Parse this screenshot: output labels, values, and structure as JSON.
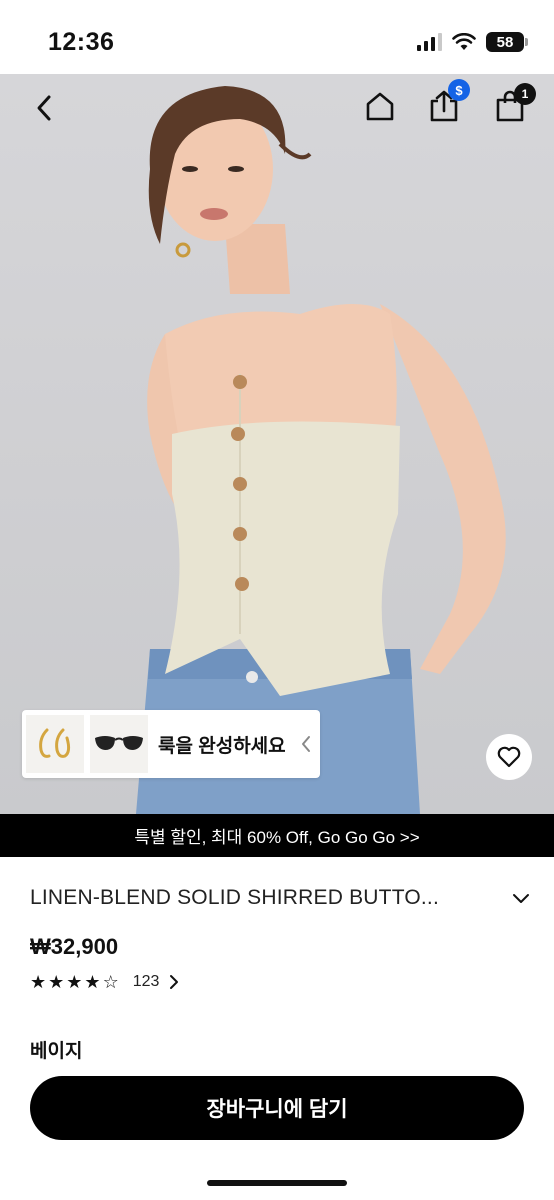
{
  "status_bar": {
    "time": "12:36",
    "battery": "58"
  },
  "header": {
    "share_badge": "$",
    "cart_badge": "1"
  },
  "look": {
    "label": "룩을 완성하세요"
  },
  "promo": {
    "text": "특별 할인, 최대 60% Off, Go Go Go >>"
  },
  "product": {
    "title": "LINEN-BLEND SOLID SHIRRED BUTTO...",
    "price": "₩32,900",
    "rating": 4,
    "rating_max": 5,
    "review_count": "123",
    "color": "베이지"
  },
  "actions": {
    "add_to_cart": "장바구니에 담기"
  },
  "colors": {
    "accent": "#000000",
    "badge_blue": "#1463e6",
    "promo_bg": "#000000"
  }
}
